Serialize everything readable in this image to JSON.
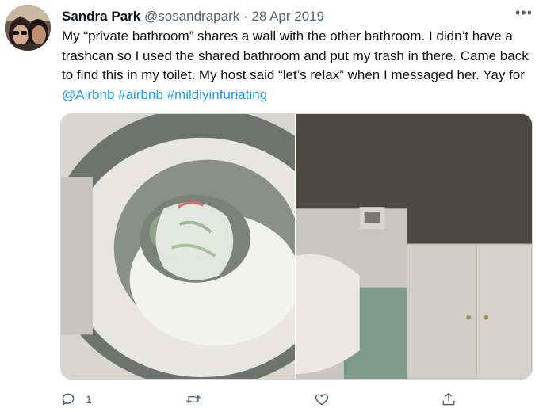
{
  "tweet": {
    "author_name": "Sandra Park",
    "handle": "@sosandrapark",
    "separator": "·",
    "date": "28 Apr 2019",
    "more_glyph": "•••",
    "text_main": "My “private bathroom” shares a wall with the other bathroom. I didn’t have a trashcan so I used the shared bathroom and put my trash in there. Came back to find this in my toilet. My host said “let’s relax” when I messaged her. Yay for ",
    "mention": "@Airbnb",
    "hashtag_1": "#airbnb",
    "hashtag_2": "#mildlyinfuriating",
    "reply_count": "1",
    "link_color": "#1d9bf0"
  },
  "icons": {
    "reply": "reply-icon",
    "retweet": "retweet-icon",
    "like": "like-icon",
    "share": "share-icon",
    "more": "more-icon"
  }
}
